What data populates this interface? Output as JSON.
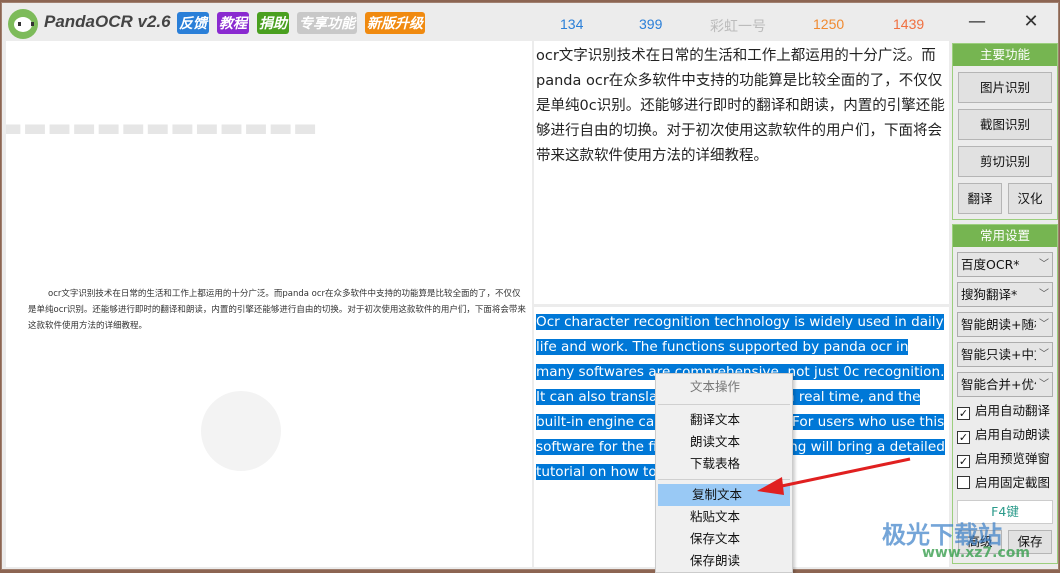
{
  "app": {
    "title": "PandaOCR v2.6",
    "badges": [
      {
        "label": "反馈",
        "color": "#2a7fd8"
      },
      {
        "label": "教程",
        "color": "#8a2ad0"
      },
      {
        "label": "捐助",
        "color": "#4aa020"
      },
      {
        "label": "专享功能",
        "color": "#c8c8c8"
      },
      {
        "label": "新版升级",
        "color": "#f08a10"
      }
    ]
  },
  "stats": [
    {
      "value": "134",
      "color": "#2a7fd8"
    },
    {
      "value": "399",
      "color": "#2a7fd8"
    },
    {
      "value": "彩虹一号",
      "color": "#bbbbbb"
    },
    {
      "value": "1250",
      "color": "#f08a30"
    },
    {
      "value": "1439",
      "color": "#f07040"
    }
  ],
  "window": {
    "minimize": "—",
    "close": "✕"
  },
  "preview": {
    "text": "ocr文字识别技术在日常的生活和工作上都运用的十分广泛。而panda ocr在众多软件中支持的功能算是比较全面的了，不仅仅是单纯ocr识别。还能够进行即时的翻译和朗读，内置的引擎还能够进行自由的切换。对于初次使用这款软件的用户们，下面将会带来这款软件使用方法的详细教程。"
  },
  "ocr_result": "ocr文字识别技术在日常的生活和工作上都运用的十分广泛。而panda ocr在众多软件中支持的功能算是比较全面的了，不仅仅是单纯0c识别。还能够进行即时的翻译和朗读，内置的引擎还能够进行自由的切换。对于初次使用这款软件的用户们，下面将会带来这款软件使用方法的详细教程。",
  "translation": "Ocr character recognition technology is widely used in daily life and work. The functions supported by panda ocr in many softwares are comprehensive, not just 0c recognition. It can also translate and read aloud in real time, and the built-in engine can also switch freely. For users who use this software for the first time, the following will bring a detailed tutorial on how to use this software.",
  "context_menu": {
    "header": "文本操作",
    "items": [
      "翻译文本",
      "朗读文本",
      "下载表格",
      "复制文本",
      "粘贴文本",
      "保存文本",
      "保存朗读"
    ],
    "highlighted": "复制文本"
  },
  "sidebar": {
    "main_title": "主要功能",
    "buttons": [
      "图片识别",
      "截图识别",
      "剪切识别"
    ],
    "translate": "翻译",
    "localize": "汉化",
    "settings_title": "常用设置",
    "selects": [
      "百度OCR*",
      "搜狗翻译*",
      "智能朗读+随机",
      "智能只读+中文",
      "智能合并+优化"
    ],
    "checkboxes": [
      {
        "label": "启用自动翻译",
        "checked": true
      },
      {
        "label": "启用自动朗读",
        "checked": true
      },
      {
        "label": "启用预览弹窗",
        "checked": true
      },
      {
        "label": "启用固定截图",
        "checked": false
      }
    ],
    "hotkey": "F4键",
    "advanced": "高级",
    "save": "保存"
  },
  "watermark": {
    "text": "极光下载站",
    "url": "www.xz7.com"
  }
}
